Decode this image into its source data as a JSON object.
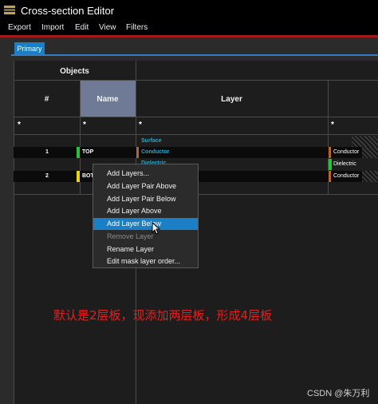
{
  "window": {
    "title": "Cross-section Editor"
  },
  "menubar": {
    "items": [
      "Export",
      "Import",
      "Edit",
      "View",
      "Filters"
    ]
  },
  "tabs": {
    "primary": "Primary"
  },
  "table": {
    "group_header": "Objects",
    "columns": {
      "index": "#",
      "name": "Name",
      "layer": "Layer"
    },
    "filter_star": "*",
    "rows": [
      {
        "layer": "Surface",
        "kind": "label"
      },
      {
        "index": "1",
        "name": "TOP",
        "layer": "Conductor",
        "right": "Conductor",
        "kind": "object"
      },
      {
        "layer": "Dielectric",
        "right": "Dielectric",
        "kind": "label"
      },
      {
        "index": "2",
        "name": "BOT",
        "right": "Conductor",
        "kind": "object"
      }
    ]
  },
  "context_menu": {
    "items": [
      {
        "label": "Add Layers..."
      },
      {
        "label": "Add Layer Pair Above"
      },
      {
        "label": "Add Layer Pair Below"
      },
      {
        "label": "Add Layer Above"
      },
      {
        "label": "Add Layer Below",
        "state": "highlighted"
      },
      {
        "label": "Remove Layer",
        "state": "disabled"
      },
      {
        "label": "Rename Layer"
      },
      {
        "label": "Edit mask layer order..."
      }
    ]
  },
  "annotation": "默认是2层板，现添加两层板，形成4层板",
  "watermark": "CSDN @朱万利",
  "colors": {
    "accent": "#1a7fc4",
    "menu_underline": "#a01818",
    "conductor_marker": "#27c23a",
    "bottom_marker": "#e8d414",
    "layer_marker": "#b8652c",
    "annotation_text": "#e32020"
  }
}
